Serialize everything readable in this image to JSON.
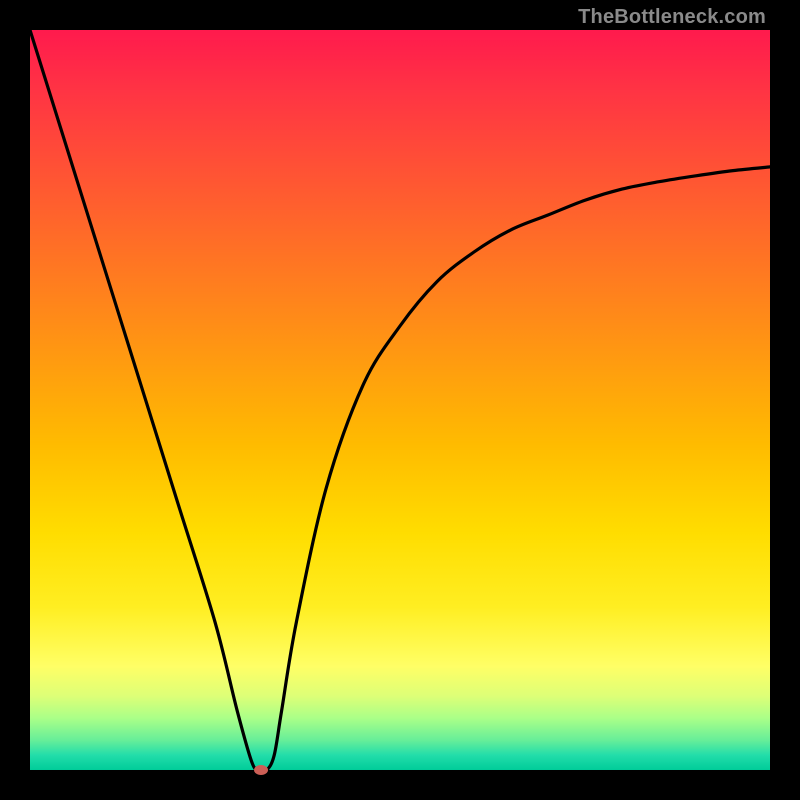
{
  "watermark": "TheBottleneck.com",
  "chart_data": {
    "type": "line",
    "title": "",
    "xlabel": "",
    "ylabel": "",
    "xlim": [
      0,
      100
    ],
    "ylim": [
      0,
      100
    ],
    "series": [
      {
        "name": "curve",
        "x": [
          0,
          5,
          10,
          15,
          20,
          25,
          28,
          30,
          31,
          32,
          33,
          34,
          36,
          40,
          45,
          50,
          55,
          60,
          65,
          70,
          75,
          80,
          85,
          90,
          95,
          100
        ],
        "y": [
          100,
          84,
          68,
          52,
          36,
          20,
          8,
          1,
          0,
          0,
          2,
          8,
          20,
          38,
          52,
          60,
          66,
          70,
          73,
          75,
          77,
          78.5,
          79.5,
          80.3,
          81,
          81.5
        ]
      }
    ],
    "marker": {
      "x": 31.2,
      "y": 0
    },
    "gradient_stops": [
      {
        "pos": 0,
        "color": "#ff1a4d"
      },
      {
        "pos": 20,
        "color": "#ff5533"
      },
      {
        "pos": 44,
        "color": "#ff9911"
      },
      {
        "pos": 68,
        "color": "#ffdd00"
      },
      {
        "pos": 86,
        "color": "#ffff66"
      },
      {
        "pos": 96,
        "color": "#66ee99"
      },
      {
        "pos": 100,
        "color": "#00cc99"
      }
    ]
  }
}
